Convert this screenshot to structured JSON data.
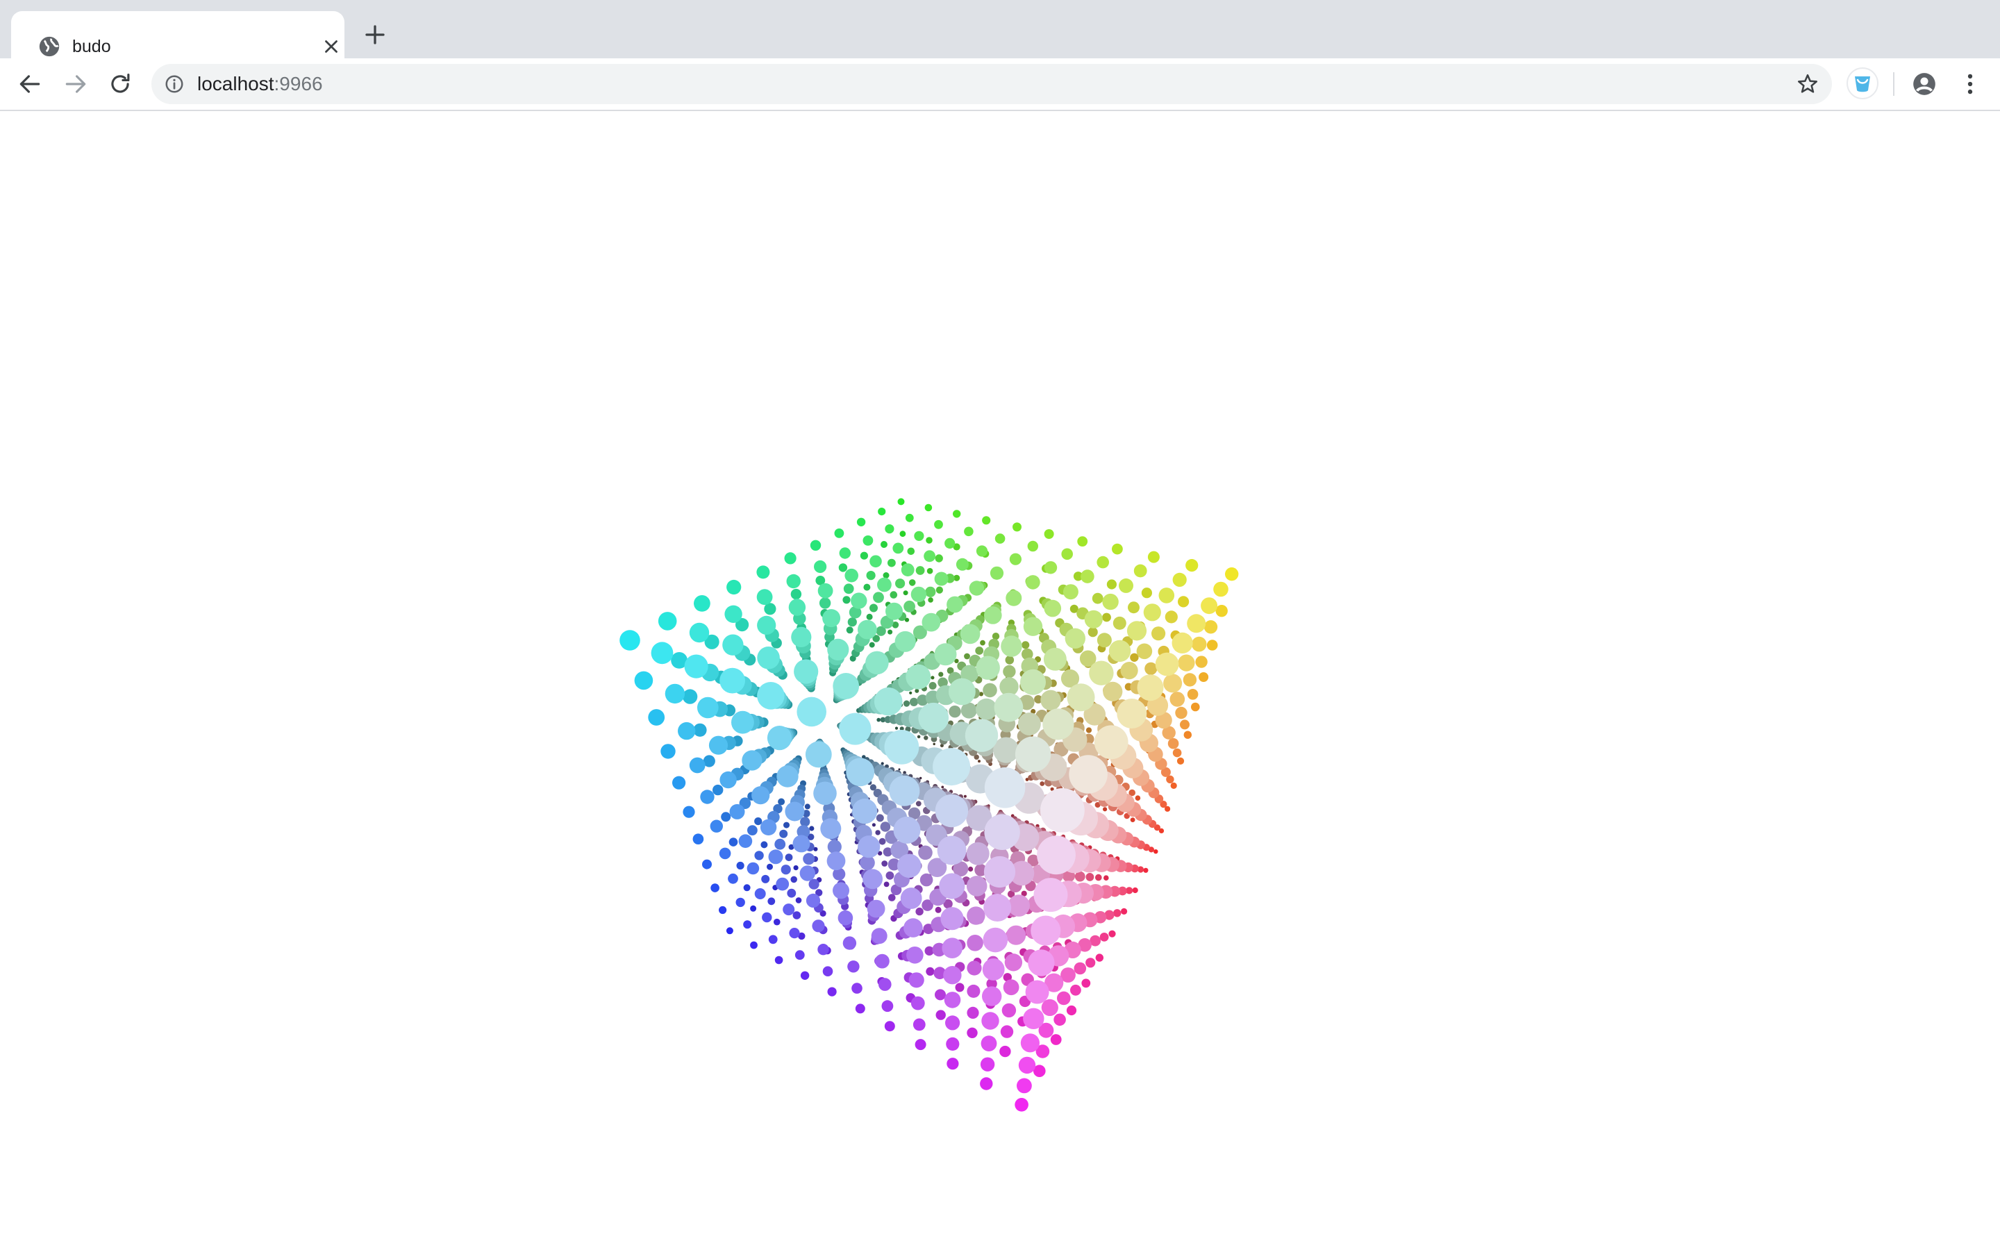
{
  "browser": {
    "tab": {
      "title": "budo",
      "favicon": "globe-icon"
    },
    "address": {
      "host": "localhost",
      "port": ":9966"
    },
    "icons": {
      "back": "arrow-left-icon",
      "forward": "arrow-right-icon",
      "reload": "reload-icon",
      "info": "info-icon",
      "bookmark": "star-icon",
      "extension": "extension-icon",
      "profile": "account-icon",
      "menu": "vertical-dots-icon",
      "close": "close-icon",
      "new_tab": "plus-icon"
    }
  },
  "page": {
    "canvas": "rgb-color-cube-point-cloud",
    "colors": {
      "corner_cyan": "#5ad8e2",
      "corner_green": "#5cd85a",
      "corner_yellow": "#dedc4a",
      "corner_red": "#d63a2f",
      "corner_magenta": "#c42ec8",
      "corner_blue": "#1f2ad0",
      "center": "#ffffff"
    }
  }
}
